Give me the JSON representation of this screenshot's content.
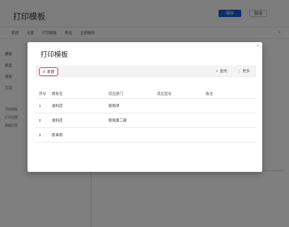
{
  "app": {
    "title": "打印模板",
    "primary_button": "保存",
    "secondary_button": "取消",
    "toolbar": [
      "新建",
      "设置",
      "打印模板",
      "预览",
      "全部删除"
    ],
    "side_labels": [
      "模板",
      "类型",
      "纸张",
      "方向"
    ],
    "left_links": [
      "添加模板",
      "打印设置",
      "高级设置"
    ]
  },
  "modal": {
    "title": "打印模板",
    "close": "×",
    "new_button": "新建",
    "search_button": "查找",
    "more_button": "更多",
    "columns": [
      "序号",
      "模板名",
      "适应部门",
      "适应型号",
      "备注"
    ],
    "rows": [
      {
        "index": "1",
        "name": "发料店",
        "dept": "新购单",
        "model": "",
        "note": ""
      },
      {
        "index": "2",
        "name": "发料店",
        "dept": "新购第二部",
        "model": "",
        "note": ""
      },
      {
        "index": "3",
        "name": "新采购",
        "dept": "",
        "model": "",
        "note": ""
      }
    ]
  }
}
